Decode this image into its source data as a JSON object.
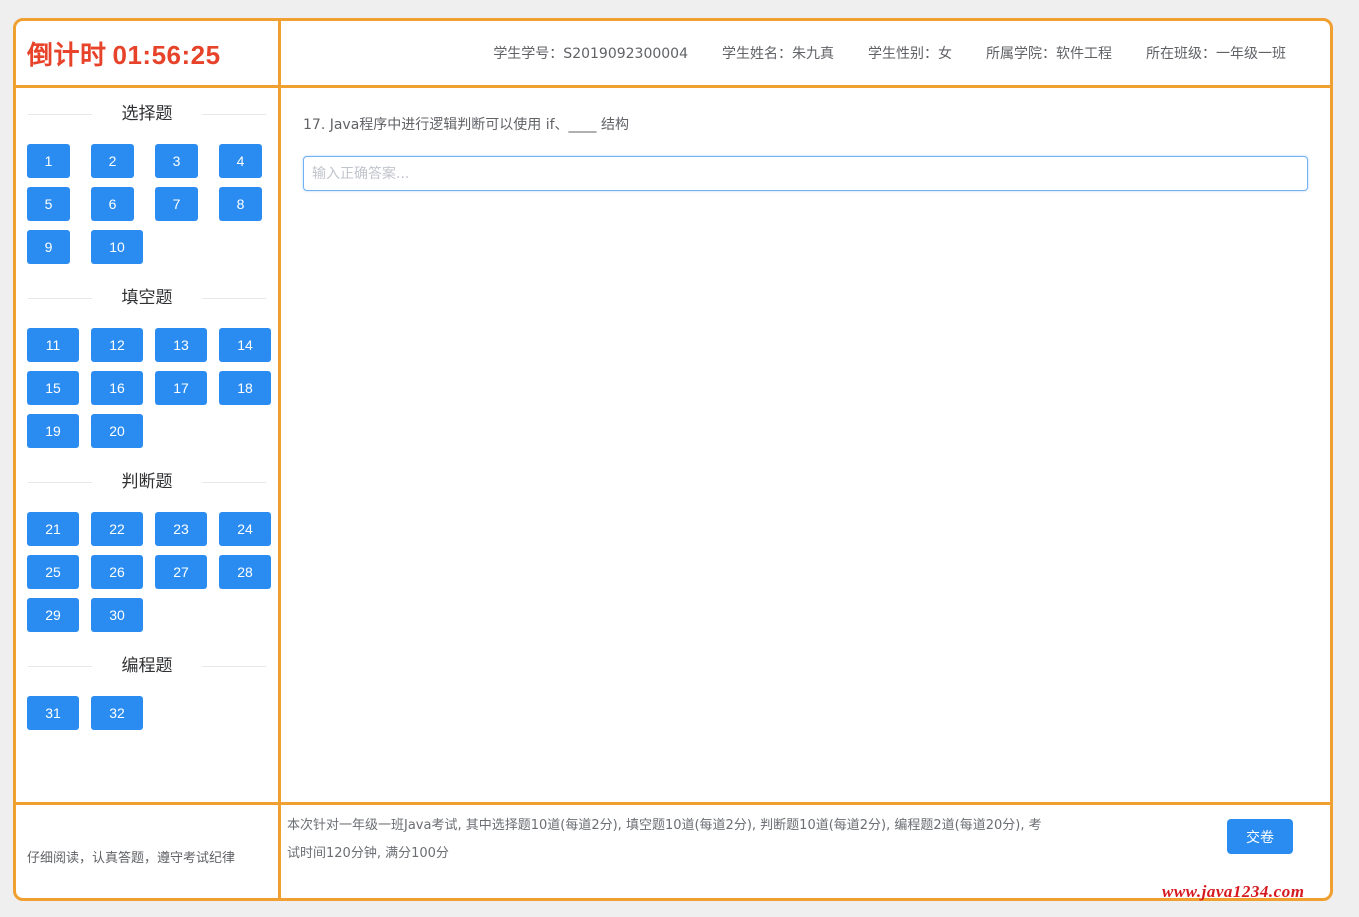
{
  "timer": {
    "label": "倒计时",
    "value": "01:56:25"
  },
  "student": {
    "id": "学生学号：S2019092300004",
    "name": "学生姓名：朱九真",
    "gender": "学生性别：女",
    "college": "所属学院：软件工程",
    "class": "所在班级：一年级一班"
  },
  "sections": [
    {
      "title": "选择题",
      "numbers": [
        "1",
        "2",
        "3",
        "4",
        "5",
        "6",
        "7",
        "8",
        "9",
        "10"
      ]
    },
    {
      "title": "填空题",
      "numbers": [
        "11",
        "12",
        "13",
        "14",
        "15",
        "16",
        "17",
        "18",
        "19",
        "20"
      ]
    },
    {
      "title": "判断题",
      "numbers": [
        "21",
        "22",
        "23",
        "24",
        "25",
        "26",
        "27",
        "28",
        "29",
        "30"
      ]
    },
    {
      "title": "编程题",
      "numbers": [
        "31",
        "32"
      ]
    }
  ],
  "question": {
    "text": "17. Java程序中进行逻辑判断可以使用 if、____ 结构",
    "placeholder": "输入正确答案...",
    "value": ""
  },
  "footer": {
    "notice": "仔细阅读，认真答题，遵守考试纪律",
    "description": "本次针对一年级一班Java考试, 其中选择题10道(每道2分), 填空题10道(每道2分), 判断题10道(每道2分), 编程题2道(每道20分), 考试时间120分钟, 满分100分",
    "submit_label": "交卷"
  },
  "watermark": "www.java1234.com",
  "colors": {
    "border": "#f0a031",
    "accent": "#2a8cf0",
    "timer": "#e6432a",
    "watermark": "#d6181f"
  }
}
